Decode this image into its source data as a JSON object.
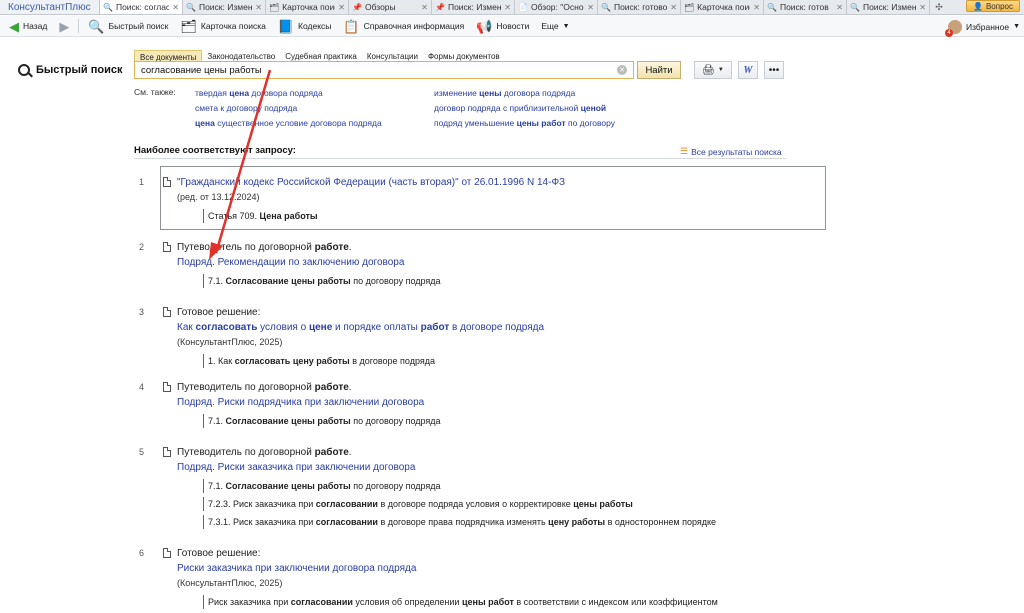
{
  "tabbar": {
    "brand": "КонсультантПлюс",
    "tabs": [
      {
        "icon": "search-icon",
        "label": "Поиск: согласова",
        "active": true
      },
      {
        "icon": "search-icon",
        "label": "Поиск: Изменени",
        "active": false
      },
      {
        "icon": "card-icon",
        "label": "Карточка поиск",
        "active": false
      },
      {
        "icon": "pin-icon",
        "label": "Обзоры",
        "active": false
      },
      {
        "icon": "pin-icon",
        "label": "Поиск: Измене",
        "active": false
      },
      {
        "icon": "doc-icon",
        "label": "Обзор: \"Осно",
        "active": false
      },
      {
        "icon": "search-icon",
        "label": "Поиск: готово",
        "active": false
      },
      {
        "icon": "card-icon",
        "label": "Карточка поис",
        "active": false
      },
      {
        "icon": "search-icon",
        "label": "Поиск: готов",
        "active": false
      },
      {
        "icon": "search-icon",
        "label": "Поиск: Измен",
        "active": false
      }
    ],
    "question_label": "Вопрос"
  },
  "toolbar": {
    "back": "Назад",
    "quick_search": "Быстрый поиск",
    "search_card": "Карточка поиска",
    "codes": "Кодексы",
    "reference": "Справочная информация",
    "news": "Новости",
    "more": "Еще",
    "favorites": "Избранное",
    "badge": "4"
  },
  "search": {
    "title": "Быстрый поиск",
    "categories": [
      "Все документы",
      "Законодательство",
      "Судебная практика",
      "Консультации",
      "Формы документов"
    ],
    "query": "согласование цены работы",
    "find_label": "Найти",
    "see_also_label": "См. также:"
  },
  "see_also": {
    "left": [
      [
        {
          "t": "твердая ",
          "b": false
        },
        {
          "t": "цена",
          "b": true
        },
        {
          "t": " договора подряда",
          "b": false
        }
      ],
      [
        {
          "t": "смета к договору подряда",
          "b": false
        }
      ],
      [
        {
          "t": "цена",
          "b": true
        },
        {
          "t": " существенное условие договора подряда",
          "b": false
        }
      ]
    ],
    "right": [
      [
        {
          "t": "изменение ",
          "b": false
        },
        {
          "t": "цены",
          "b": true
        },
        {
          "t": " договора подряда",
          "b": false
        }
      ],
      [
        {
          "t": "договор подряда с приблизительной ",
          "b": false
        },
        {
          "t": "ценой",
          "b": true
        }
      ],
      [
        {
          "t": "подряд уменьшение ",
          "b": false
        },
        {
          "t": "цены работ",
          "b": true
        },
        {
          "t": " по договору",
          "b": false
        }
      ]
    ]
  },
  "results_header": {
    "title": "Наиболее соответствуют запросу:",
    "all_results": "Все результаты поиска"
  },
  "results": [
    {
      "num": "1",
      "type": [],
      "title": [
        {
          "t": "\"Гражданский кодекс Российской Федерации (часть вторая)\" от 26.01.1996 N 14-ФЗ",
          "b": false
        }
      ],
      "meta": "(ред. от 13.12.2024)",
      "fragments": [
        [
          {
            "t": "Статья 709. ",
            "b": false
          },
          {
            "t": "Цена работы",
            "b": true
          }
        ]
      ]
    },
    {
      "num": "2",
      "type": [
        {
          "t": "Путеводитель по договорной ",
          "b": false
        },
        {
          "t": "работе",
          "b": true
        },
        {
          "t": ".",
          "b": false
        }
      ],
      "title": [
        {
          "t": "Подряд. Рекомендации по заключению договора",
          "b": false
        }
      ],
      "meta": "",
      "fragments": [
        [
          {
            "t": "7.1. ",
            "b": false
          },
          {
            "t": "Согласование цены работы",
            "b": true
          },
          {
            "t": " по договору подряда",
            "b": false
          }
        ]
      ]
    },
    {
      "num": "3",
      "type": [
        {
          "t": "Готовое решение:",
          "b": false
        }
      ],
      "title": [
        {
          "t": "Как ",
          "b": false
        },
        {
          "t": "согласовать",
          "b": true
        },
        {
          "t": " условия о ",
          "b": false
        },
        {
          "t": "цене",
          "b": true
        },
        {
          "t": " и порядке оплаты ",
          "b": false
        },
        {
          "t": "работ",
          "b": true
        },
        {
          "t": " в договоре подряда",
          "b": false
        }
      ],
      "meta": "(КонсультантПлюс, 2025)",
      "fragments": [
        [
          {
            "t": "1. Как ",
            "b": false
          },
          {
            "t": "согласовать цену работы",
            "b": true
          },
          {
            "t": " в договоре подряда",
            "b": false
          }
        ]
      ]
    },
    {
      "num": "4",
      "type": [
        {
          "t": "Путеводитель по договорной ",
          "b": false
        },
        {
          "t": "работе",
          "b": true
        },
        {
          "t": ".",
          "b": false
        }
      ],
      "title": [
        {
          "t": "Подряд. Риски подрядчика при заключении договора",
          "b": false
        }
      ],
      "meta": "",
      "fragments": [
        [
          {
            "t": "7.1. ",
            "b": false
          },
          {
            "t": "Согласование цены работы",
            "b": true
          },
          {
            "t": " по договору подряда",
            "b": false
          }
        ]
      ]
    },
    {
      "num": "5",
      "type": [
        {
          "t": "Путеводитель по договорной ",
          "b": false
        },
        {
          "t": "работе",
          "b": true
        },
        {
          "t": ".",
          "b": false
        }
      ],
      "title": [
        {
          "t": "Подряд. Риски заказчика при заключении договора",
          "b": false
        }
      ],
      "meta": "",
      "fragments": [
        [
          {
            "t": "7.1. ",
            "b": false
          },
          {
            "t": "Согласование цены работы",
            "b": true
          },
          {
            "t": " по договору подряда",
            "b": false
          }
        ],
        [
          {
            "t": "7.2.3. Риск заказчика при ",
            "b": false
          },
          {
            "t": "согласовании",
            "b": true
          },
          {
            "t": " в договоре подряда условия о корректировке ",
            "b": false
          },
          {
            "t": "цены работы",
            "b": true
          }
        ],
        [
          {
            "t": "7.3.1. Риск заказчика при ",
            "b": false
          },
          {
            "t": "согласовании",
            "b": true
          },
          {
            "t": " в договоре права подрядчика изменять ",
            "b": false
          },
          {
            "t": "цену работы",
            "b": true
          },
          {
            "t": " в одностороннем порядке",
            "b": false
          }
        ]
      ]
    },
    {
      "num": "6",
      "type": [
        {
          "t": "Готовое решение:",
          "b": false
        }
      ],
      "title": [
        {
          "t": "Риски заказчика при заключении договора подряда",
          "b": false
        }
      ],
      "meta": "(КонсультантПлюс, 2025)",
      "fragments": [
        [
          {
            "t": "Риск заказчика при ",
            "b": false
          },
          {
            "t": "согласовании",
            "b": true
          },
          {
            "t": " условия об определении ",
            "b": false
          },
          {
            "t": "цены работ",
            "b": true
          },
          {
            "t": " в соответствии с индексом или коэффициентом",
            "b": false
          }
        ]
      ]
    }
  ],
  "colors": {
    "link": "#2a3ea0",
    "annotation_arrow": "#e0312a",
    "search_border": "#e0b455"
  }
}
